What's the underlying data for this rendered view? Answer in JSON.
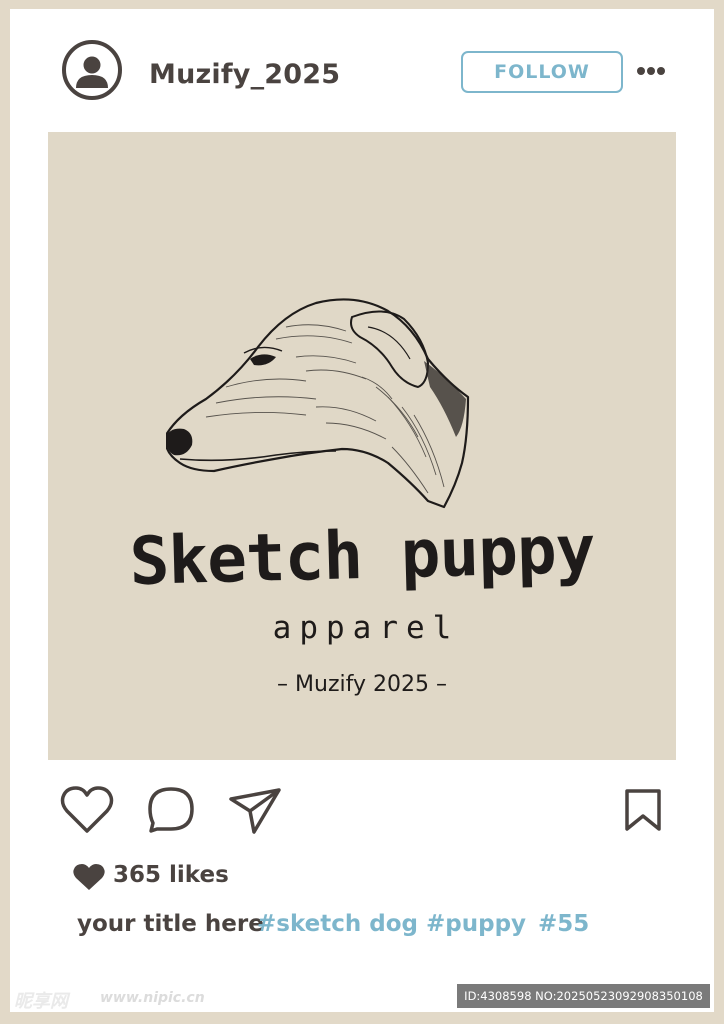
{
  "header": {
    "username": "Muzify_2025",
    "follow_label": "FOLLOW",
    "avatar_icon": "user-avatar-icon",
    "more_icon": "more-dots-icon"
  },
  "post": {
    "image_title": "Sketch puppy",
    "image_subtitle": "apparel",
    "image_credit": "– Muzify 2025 –",
    "image_subject": "dog-sketch"
  },
  "actions": {
    "like_icon": "heart-icon",
    "comment_icon": "comment-icon",
    "share_icon": "send-icon",
    "bookmark_icon": "bookmark-icon"
  },
  "likes": {
    "label": "365 likes"
  },
  "caption": {
    "title": "your title here",
    "hashtags": [
      "#sketch dog",
      "#puppy",
      "#55"
    ]
  },
  "watermark": {
    "logo_text": "昵享网",
    "url": "www.nipic.cn",
    "id_text": "ID:4308598 NO:20250523092908350108"
  },
  "colors": {
    "background": "#e2d9c8",
    "card": "#ffffff",
    "image_bg": "#e0d8c7",
    "text_dark": "#4a4340",
    "accent_blue": "#7db6cc",
    "ink": "#1e1b1a"
  }
}
